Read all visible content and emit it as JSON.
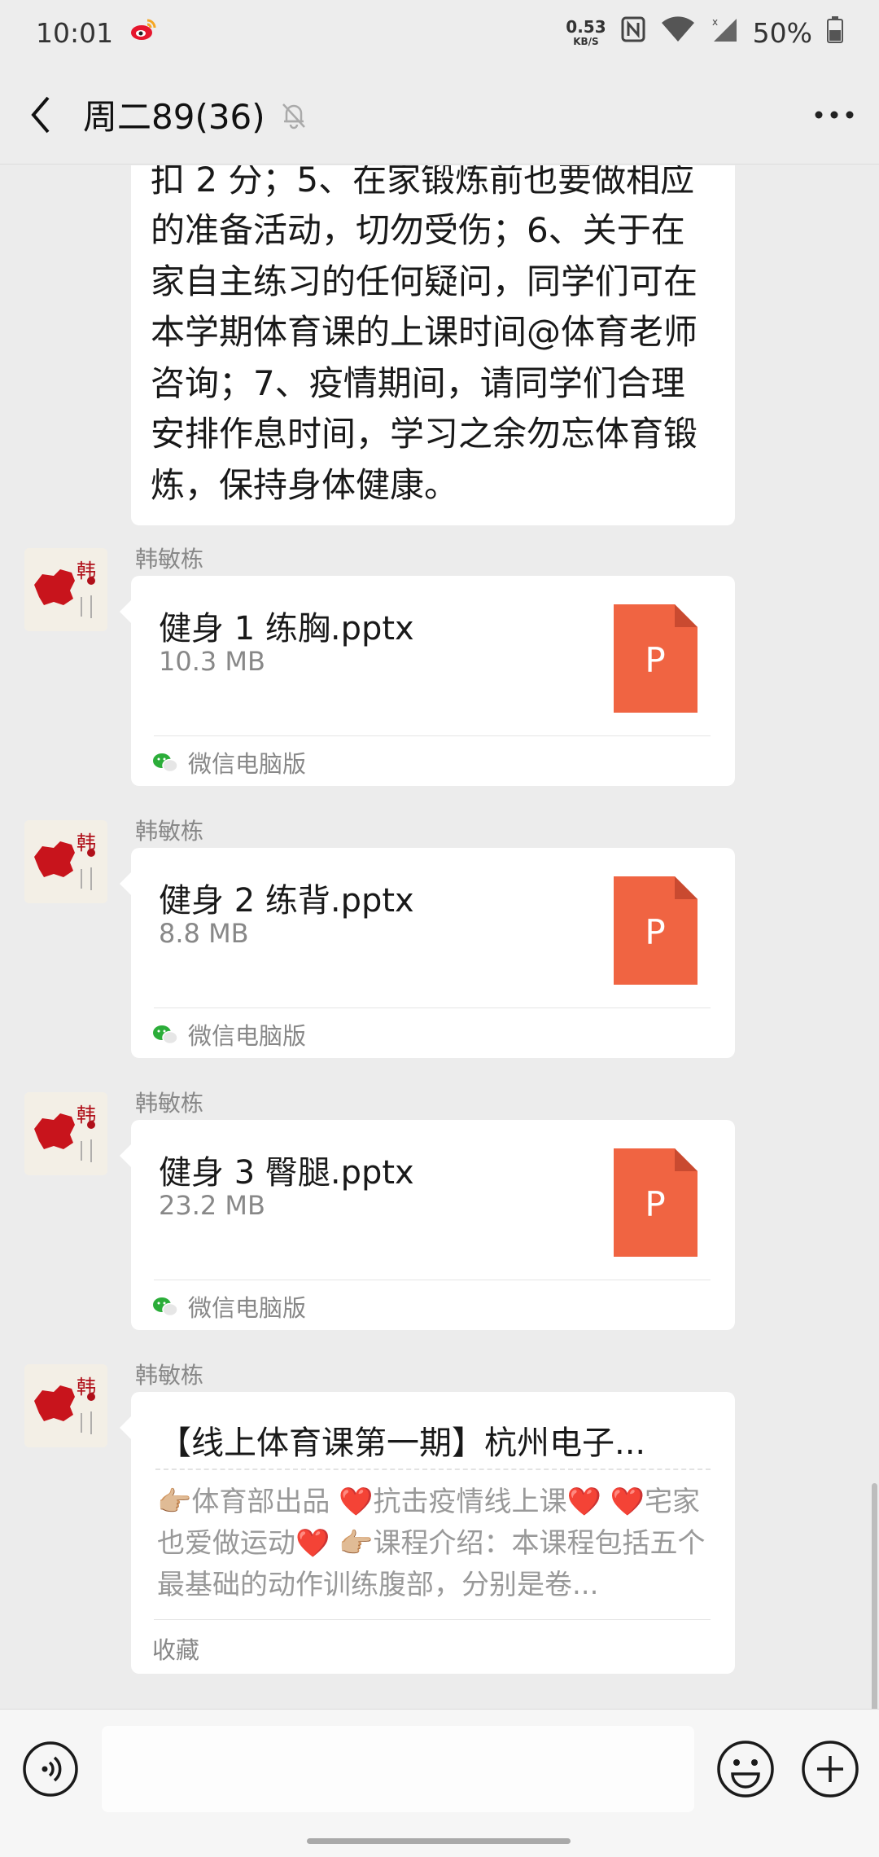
{
  "status_bar": {
    "time": "10:01",
    "net_speed_value": "0.53",
    "net_speed_unit": "KB/S",
    "battery": "50%"
  },
  "header": {
    "title": "周二89(36)"
  },
  "messages": {
    "text_message": "扣 2 分；5、在家锻炼前也要做相应的准备活动，切勿受伤；6、关于在家自主练习的任何疑问，同学们可在本学期体育课的上课时间@体育老师咨询；7、疫情期间，请同学们合理安排作息时间，学习之余勿忘体育锻炼，保持身体健康。",
    "file1": {
      "sender": "韩敏栋",
      "name": "健身 1 练胸.pptx",
      "size": "10.3 MB",
      "source": "微信电脑版",
      "icon_letter": "P"
    },
    "file2": {
      "sender": "韩敏栋",
      "name": "健身 2 练背.pptx",
      "size": "8.8 MB",
      "source": "微信电脑版",
      "icon_letter": "P"
    },
    "file3": {
      "sender": "韩敏栋",
      "name": "健身 3 臀腿.pptx",
      "size": "23.2 MB",
      "source": "微信电脑版",
      "icon_letter": "P"
    },
    "link": {
      "sender": "韩敏栋",
      "title": "【线上体育课第一期】杭州电子...",
      "desc_1": "体育部出品 ",
      "desc_2": "抗击疫情线上课",
      "desc_3": "宅家也爱做运动",
      "desc_4": "课程介绍：本课程包括五个最基础的动作训练腹部，分别是卷...",
      "footer": "收藏"
    }
  },
  "colors": {
    "ppt_orange": "#f06442",
    "background": "#ececec",
    "bubble": "#ffffff"
  }
}
